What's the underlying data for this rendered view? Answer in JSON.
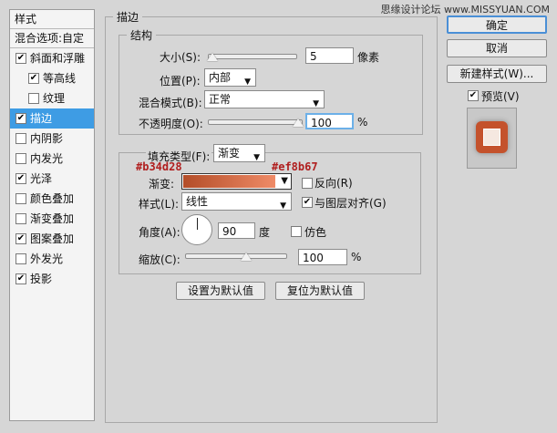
{
  "watermark": "思缘设计论坛 www.MISSYUAN.COM",
  "sidebar": {
    "title": "样式",
    "blend_options": "混合选项:自定",
    "items": [
      {
        "label": "斜面和浮雕",
        "checked": true
      },
      {
        "label": "等高线",
        "checked": true
      },
      {
        "label": "纹理",
        "checked": false
      },
      {
        "label": "描边",
        "checked": true
      },
      {
        "label": "内阴影",
        "checked": false
      },
      {
        "label": "内发光",
        "checked": false
      },
      {
        "label": "光泽",
        "checked": true
      },
      {
        "label": "颜色叠加",
        "checked": false
      },
      {
        "label": "渐变叠加",
        "checked": false
      },
      {
        "label": "图案叠加",
        "checked": true
      },
      {
        "label": "外发光",
        "checked": false
      },
      {
        "label": "投影",
        "checked": true
      }
    ]
  },
  "stroke": {
    "title": "描边",
    "structure": {
      "title": "结构",
      "size_label": "大小(S):",
      "size_value": "5",
      "size_unit": "像素",
      "position_label": "位置(P):",
      "position_value": "内部",
      "blend_label": "混合模式(B):",
      "blend_value": "正常",
      "opacity_label": "不透明度(O):",
      "opacity_value": "100",
      "opacity_unit": "%"
    },
    "fill": {
      "type_label": "填充类型(F):",
      "type_value": "渐变",
      "gradient_label": "渐变:",
      "color_start": "#b34d28",
      "color_end": "#ef8b67",
      "reverse_label": "反向(R)",
      "reverse_checked": false,
      "style_label": "样式(L):",
      "style_value": "线性",
      "align_label": "与图层对齐(G)",
      "align_checked": true,
      "angle_label": "角度(A):",
      "angle_value": "90",
      "angle_unit": "度",
      "dither_label": "仿色",
      "dither_checked": false,
      "scale_label": "缩放(C):",
      "scale_value": "100",
      "scale_unit": "%"
    },
    "default_button": "设置为默认值",
    "reset_button": "复位为默认值"
  },
  "right": {
    "ok_button": "确定",
    "cancel_button": "取消",
    "new_style_button": "新建样式(W)...",
    "preview_label": "预览(V)",
    "preview_checked": true
  }
}
